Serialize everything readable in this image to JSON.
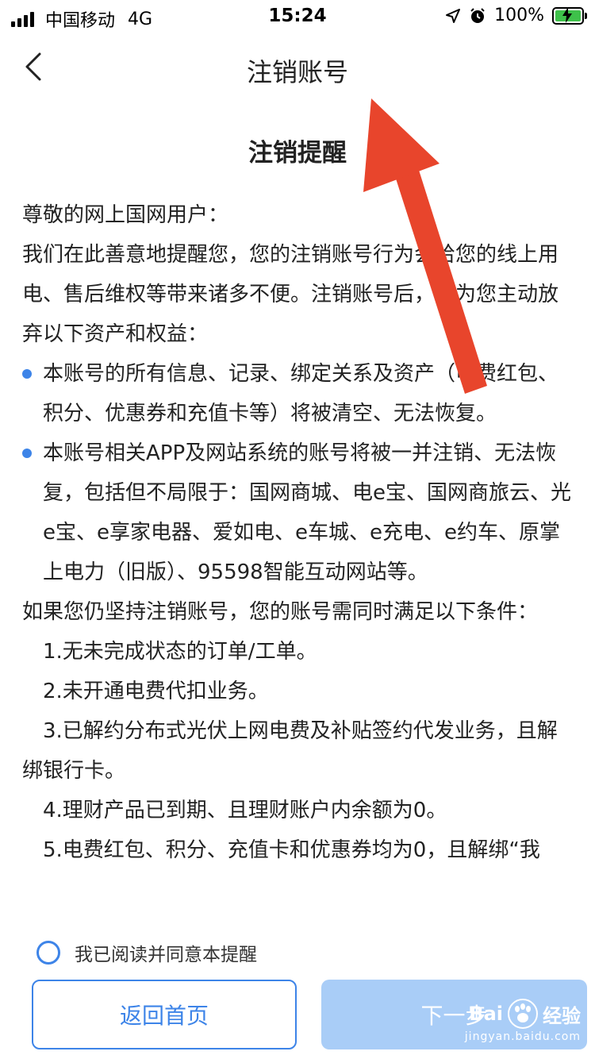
{
  "status_bar": {
    "carrier": "中国移动",
    "network": "4G",
    "time": "15:24",
    "battery": "100%"
  },
  "nav": {
    "title": "注销账号"
  },
  "notice": {
    "heading": "注销提醒",
    "greeting": "尊敬的网上国网用户：",
    "intro": "我们在此善意地提醒您，您的注销账号行为会给您的线上用电、售后维权等带来诸多不便。注销账号后，视为您主动放弃以下资产和权益：",
    "bullets": [
      "本账号的所有信息、记录、绑定关系及资产（电费红包、积分、优惠券和充值卡等）将被清空、无法恢复。",
      "本账号相关APP及网站系统的账号将被一并注销、无法恢复，包括但不局限于：国网商城、电e宝、国网商旅云、光e宝、e享家电器、爱如电、e车城、e充电、e约车、原掌上电力（旧版）、95598智能互动网站等。"
    ],
    "conditions_intro": "如果您仍坚持注销账号，您的账号需同时满足以下条件：",
    "conditions": [
      "1.无未完成状态的订单/工单。",
      "2.未开通电费代扣业务。",
      "3.已解约分布式光伏上网电费及补贴签约代发业务，且解绑银行卡。",
      "4.理财产品已到期、且理财账户内余额为0。",
      "5.电费红包、积分、充值卡和优惠券均为0，且解绑“我"
    ]
  },
  "agree": {
    "label": "我已阅读并同意本提醒"
  },
  "buttons": {
    "home": "返回首页",
    "next": "下一步"
  },
  "watermark": {
    "brand": "Bai",
    "brand2": "经验",
    "site": "jingyan.baidu.com"
  },
  "colors": {
    "accent": "#3d84e8",
    "disabled": "#a9cdf7",
    "arrow": "#e8452c"
  }
}
